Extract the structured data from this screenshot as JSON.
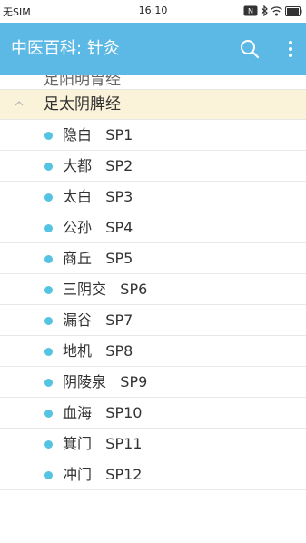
{
  "status_bar": {
    "carrier": "无SIM",
    "time": "16:10"
  },
  "app_bar": {
    "title": "中医百科: 针灸",
    "search_icon": "search-icon",
    "more_icon": "more-vert-icon"
  },
  "list": {
    "previous_group_partial": "足阳明胃经",
    "group": {
      "title": "足太阴脾经",
      "expanded": true,
      "chevron_icon": "chevron-up-icon",
      "header_color": "#fbf3d9"
    },
    "dot_color": "#55c3e2",
    "points": [
      {
        "name": "隐白",
        "code": "SP1"
      },
      {
        "name": "大都",
        "code": "SP2"
      },
      {
        "name": "太白",
        "code": "SP3"
      },
      {
        "name": "公孙",
        "code": "SP4"
      },
      {
        "name": "商丘",
        "code": "SP5"
      },
      {
        "name": "三阴交",
        "code": "SP6"
      },
      {
        "name": "漏谷",
        "code": "SP7"
      },
      {
        "name": "地机",
        "code": "SP8"
      },
      {
        "name": "阴陵泉",
        "code": "SP9"
      },
      {
        "name": "血海",
        "code": "SP10"
      },
      {
        "name": "箕门",
        "code": "SP11"
      },
      {
        "name": "冲门",
        "code": "SP12"
      }
    ]
  }
}
